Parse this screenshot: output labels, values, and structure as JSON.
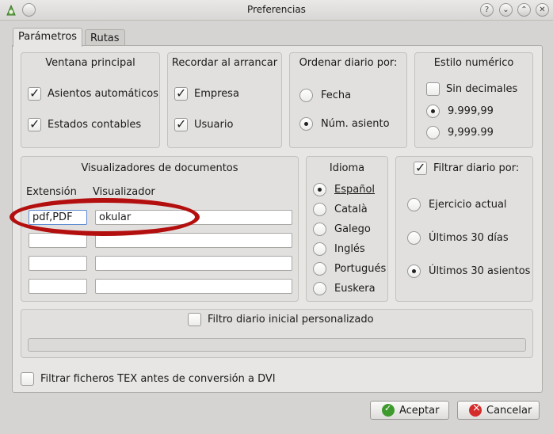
{
  "window": {
    "title": "Preferencias",
    "buttons": [
      "?",
      "⌄",
      "⌃",
      "✕"
    ]
  },
  "tabs": [
    {
      "label": "Parámetros",
      "active": true
    },
    {
      "label": "Rutas",
      "active": false
    }
  ],
  "ventana_principal": {
    "title": "Ventana principal",
    "items": [
      {
        "label": "Asientos automáticos",
        "checked": true
      },
      {
        "label": "Estados contables",
        "checked": true
      }
    ]
  },
  "recordar": {
    "title": "Recordar al arrancar",
    "items": [
      {
        "label": "Empresa",
        "checked": true
      },
      {
        "label": "Usuario",
        "checked": true
      }
    ]
  },
  "ordenar": {
    "title": "Ordenar diario por:",
    "options": [
      {
        "label": "Fecha",
        "selected": false
      },
      {
        "label": "Núm. asiento",
        "selected": true
      }
    ]
  },
  "estilo": {
    "title": "Estilo numérico",
    "sin_decimales": {
      "label": "Sin decimales",
      "checked": false
    },
    "options": [
      {
        "label": "9.999,99",
        "selected": true
      },
      {
        "label": "9,999.99",
        "selected": false
      }
    ]
  },
  "visualizadores": {
    "title": "Visualizadores de documentos",
    "col_extension": "Extensión",
    "col_visualizador": "Visualizador",
    "rows": [
      {
        "ext": "pdf,PDF",
        "viewer": "okular"
      },
      {
        "ext": "",
        "viewer": ""
      },
      {
        "ext": "",
        "viewer": ""
      },
      {
        "ext": "",
        "viewer": ""
      }
    ]
  },
  "idioma": {
    "title": "Idioma",
    "options": [
      {
        "label": "Español",
        "selected": true
      },
      {
        "label": "Català",
        "selected": false
      },
      {
        "label": "Galego",
        "selected": false
      },
      {
        "label": "Inglés",
        "selected": false
      },
      {
        "label": "Portugués",
        "selected": false
      },
      {
        "label": "Euskera",
        "selected": false
      }
    ]
  },
  "filtrar": {
    "title": "Filtrar diario por:",
    "checked": true,
    "options": [
      {
        "label": "Ejercicio actual",
        "selected": false
      },
      {
        "label": "Últimos 30 días",
        "selected": false
      },
      {
        "label": "Últimos 30 asientos",
        "selected": true
      }
    ]
  },
  "filtro_inicial": {
    "label": "Filtro diario inicial personalizado",
    "checked": false
  },
  "filtrar_tex": {
    "label": "Filtrar ficheros TEX antes de conversión a DVI",
    "checked": false
  },
  "footer": {
    "accept": "Aceptar",
    "cancel": "Cancelar"
  },
  "colors": {
    "annotation": "#b40f0f",
    "ok_icon": "#3f9a2e",
    "cancel_icon": "#d42b2b"
  }
}
